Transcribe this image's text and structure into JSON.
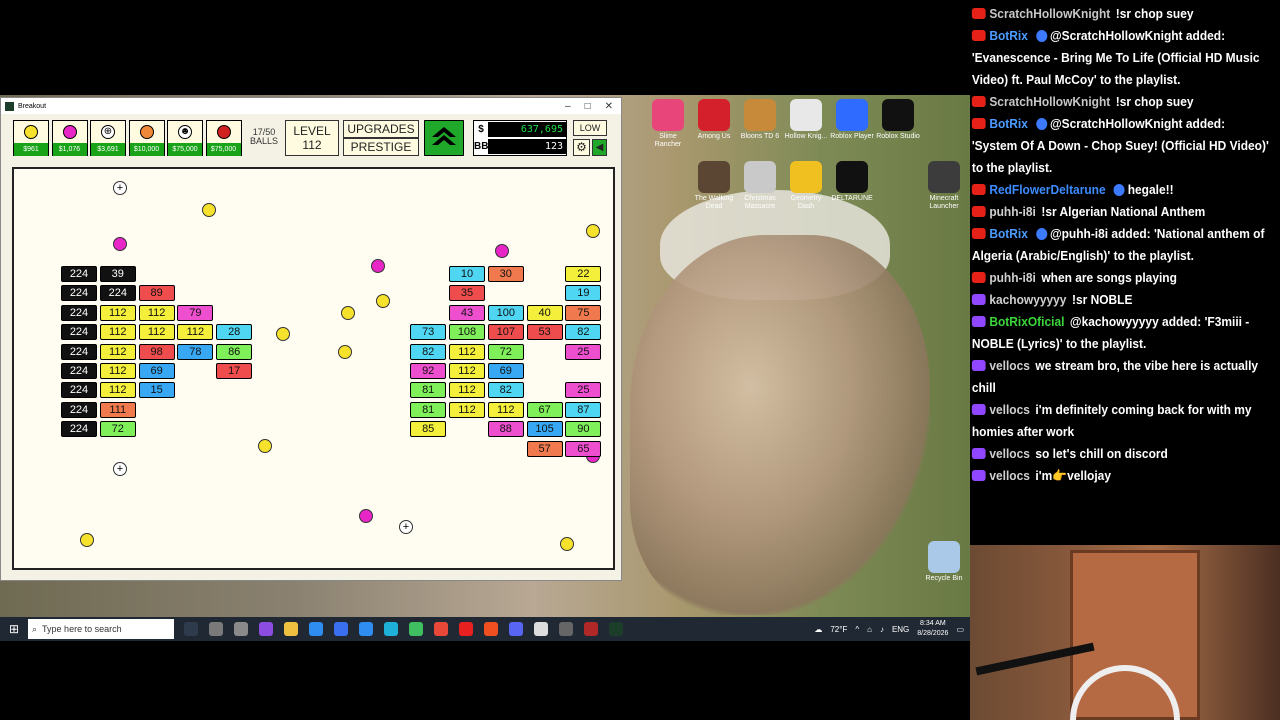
{
  "window": {
    "title": "Breakout"
  },
  "hud": {
    "balls": [
      {
        "icon": "yellow-ball",
        "price": "$961",
        "color": "#f6e22c",
        "glyph": ""
      },
      {
        "icon": "pink-ball",
        "price": "$1,076",
        "color": "#e826c8",
        "glyph": ""
      },
      {
        "icon": "plus-ball",
        "price": "$3,691",
        "color": "#ffffff",
        "glyph": "⊕"
      },
      {
        "icon": "orange-ball",
        "price": "$10,000",
        "color": "#f0883a",
        "glyph": ""
      },
      {
        "icon": "skull-ball",
        "price": "$75,000",
        "color": "#ffffff",
        "glyph": "☻"
      },
      {
        "icon": "red-ball",
        "price": "$75,000",
        "color": "#d02020",
        "glyph": ""
      }
    ],
    "ball_count": "17/50",
    "balls_label": "BALLS",
    "level_label": "LEVEL",
    "level_value": "112",
    "upgrades_label": "UPGRADES",
    "prestige_label": "PRESTIGE",
    "money_symbol": "$",
    "money_value": "637,695",
    "bb_label": "BB",
    "bb_value": "123",
    "quality_label": "LOW"
  },
  "bricks": [
    {
      "c": 0,
      "r": 0,
      "v": "224",
      "k": "k"
    },
    {
      "c": 1,
      "r": 0,
      "v": "39",
      "k": "k"
    },
    {
      "c": 0,
      "r": 1,
      "v": "224",
      "k": "k"
    },
    {
      "c": 1,
      "r": 1,
      "v": "224",
      "k": "k"
    },
    {
      "c": 2,
      "r": 1,
      "v": "89",
      "k": "red"
    },
    {
      "c": 0,
      "r": 2,
      "v": "224",
      "k": "k"
    },
    {
      "c": 1,
      "r": 2,
      "v": "112",
      "k": "yellow"
    },
    {
      "c": 2,
      "r": 2,
      "v": "112",
      "k": "yellow"
    },
    {
      "c": 3,
      "r": 2,
      "v": "79",
      "k": "pink"
    },
    {
      "c": 0,
      "r": 3,
      "v": "224",
      "k": "k"
    },
    {
      "c": 1,
      "r": 3,
      "v": "112",
      "k": "yellow"
    },
    {
      "c": 2,
      "r": 3,
      "v": "112",
      "k": "yellow"
    },
    {
      "c": 3,
      "r": 3,
      "v": "112",
      "k": "yellow"
    },
    {
      "c": 4,
      "r": 3,
      "v": "28",
      "k": "cyan"
    },
    {
      "c": 0,
      "r": 4,
      "v": "224",
      "k": "k"
    },
    {
      "c": 1,
      "r": 4,
      "v": "112",
      "k": "yellow"
    },
    {
      "c": 2,
      "r": 4,
      "v": "98",
      "k": "red"
    },
    {
      "c": 3,
      "r": 4,
      "v": "78",
      "k": "blue"
    },
    {
      "c": 4,
      "r": 4,
      "v": "86",
      "k": "green"
    },
    {
      "c": 0,
      "r": 5,
      "v": "224",
      "k": "k"
    },
    {
      "c": 1,
      "r": 5,
      "v": "112",
      "k": "yellow"
    },
    {
      "c": 2,
      "r": 5,
      "v": "69",
      "k": "blue"
    },
    {
      "c": 4,
      "r": 5,
      "v": "17",
      "k": "red"
    },
    {
      "c": 0,
      "r": 6,
      "v": "224",
      "k": "k"
    },
    {
      "c": 1,
      "r": 6,
      "v": "112",
      "k": "yellow"
    },
    {
      "c": 2,
      "r": 6,
      "v": "15",
      "k": "blue"
    },
    {
      "c": 0,
      "r": 7,
      "v": "224",
      "k": "k"
    },
    {
      "c": 1,
      "r": 7,
      "v": "111",
      "k": "orange"
    },
    {
      "c": 0,
      "r": 8,
      "v": "224",
      "k": "k"
    },
    {
      "c": 1,
      "r": 8,
      "v": "72",
      "k": "green"
    },
    {
      "c": 10,
      "r": 0,
      "v": "10",
      "k": "cyan"
    },
    {
      "c": 11,
      "r": 0,
      "v": "30",
      "k": "orange"
    },
    {
      "c": 13,
      "r": 0,
      "v": "22",
      "k": "yellow"
    },
    {
      "c": 10,
      "r": 1,
      "v": "35",
      "k": "red"
    },
    {
      "c": 13,
      "r": 1,
      "v": "19",
      "k": "cyan"
    },
    {
      "c": 10,
      "r": 2,
      "v": "43",
      "k": "pink"
    },
    {
      "c": 11,
      "r": 2,
      "v": "100",
      "k": "cyan"
    },
    {
      "c": 12,
      "r": 2,
      "v": "40",
      "k": "yellow"
    },
    {
      "c": 13,
      "r": 2,
      "v": "75",
      "k": "orange"
    },
    {
      "c": 9,
      "r": 3,
      "v": "73",
      "k": "cyan"
    },
    {
      "c": 10,
      "r": 3,
      "v": "108",
      "k": "green"
    },
    {
      "c": 11,
      "r": 3,
      "v": "107",
      "k": "red"
    },
    {
      "c": 12,
      "r": 3,
      "v": "53",
      "k": "red"
    },
    {
      "c": 13,
      "r": 3,
      "v": "82",
      "k": "cyan"
    },
    {
      "c": 9,
      "r": 4,
      "v": "82",
      "k": "cyan"
    },
    {
      "c": 10,
      "r": 4,
      "v": "112",
      "k": "yellow"
    },
    {
      "c": 11,
      "r": 4,
      "v": "72",
      "k": "green"
    },
    {
      "c": 13,
      "r": 4,
      "v": "25",
      "k": "pink"
    },
    {
      "c": 9,
      "r": 5,
      "v": "92",
      "k": "pink"
    },
    {
      "c": 10,
      "r": 5,
      "v": "112",
      "k": "yellow"
    },
    {
      "c": 11,
      "r": 5,
      "v": "69",
      "k": "blue"
    },
    {
      "c": 9,
      "r": 6,
      "v": "81",
      "k": "green"
    },
    {
      "c": 10,
      "r": 6,
      "v": "112",
      "k": "yellow"
    },
    {
      "c": 11,
      "r": 6,
      "v": "82",
      "k": "cyan"
    },
    {
      "c": 13,
      "r": 6,
      "v": "25",
      "k": "pink"
    },
    {
      "c": 9,
      "r": 7,
      "v": "81",
      "k": "green"
    },
    {
      "c": 10,
      "r": 7,
      "v": "112",
      "k": "yellow"
    },
    {
      "c": 11,
      "r": 7,
      "v": "112",
      "k": "yellow"
    },
    {
      "c": 12,
      "r": 7,
      "v": "67",
      "k": "green"
    },
    {
      "c": 13,
      "r": 7,
      "v": "87",
      "k": "cyan"
    },
    {
      "c": 9,
      "r": 8,
      "v": "85",
      "k": "yellow"
    },
    {
      "c": 11,
      "r": 8,
      "v": "88",
      "k": "pink"
    },
    {
      "c": 12,
      "r": 8,
      "v": "105",
      "k": "blue"
    },
    {
      "c": 13,
      "r": 8,
      "v": "90",
      "k": "green"
    },
    {
      "c": 12,
      "r": 9,
      "v": "57",
      "k": "orange"
    },
    {
      "c": 13,
      "r": 9,
      "v": "65",
      "k": "pink"
    }
  ],
  "brick_colors": {
    "k": "#111111",
    "red": "#ef4d4d",
    "yellow": "#f4ef3a",
    "pink": "#ee4fcf",
    "cyan": "#4fd6f2",
    "blue": "#38a8f4",
    "green": "#7ff05a",
    "orange": "#f07a4e"
  },
  "desktop_icons": [
    {
      "name": "slime-rancher",
      "label": "Slime Rancher",
      "color": "#e8457b"
    },
    {
      "name": "among-us",
      "label": "Among Us",
      "color": "#d4202a"
    },
    {
      "name": "bloons-td6",
      "label": "Bloons TD 6",
      "color": "#c78a3b"
    },
    {
      "name": "hollow-knight",
      "label": "Hollow Knig...",
      "color": "#e8e8e8"
    },
    {
      "name": "roblox-player",
      "label": "Roblox Player",
      "color": "#2f6bff"
    },
    {
      "name": "roblox-studio",
      "label": "Roblox Studio",
      "color": "#111111"
    },
    {
      "name": "walking-dead",
      "label": "The Walking Dead",
      "color": "#5a4632"
    },
    {
      "name": "christmas-massacre",
      "label": "Christmas Massacre",
      "color": "#c9c9c9"
    },
    {
      "name": "geometry-dash",
      "label": "Geometry Dash",
      "color": "#f0c020"
    },
    {
      "name": "deltarune",
      "label": "DELTARUNE",
      "color": "#111111"
    },
    {
      "name": "minecraft",
      "label": "Minecraft Launcher",
      "color": "#3c3c3c"
    },
    {
      "name": "recycle-bin",
      "label": "Recycle Bin",
      "color": "#aac8e8"
    }
  ],
  "taskbar": {
    "search_placeholder": "Type here to search",
    "weather": "72°F",
    "lang": "ENG",
    "time": "8:34 AM",
    "date": "8/28/2026"
  },
  "chat": [
    {
      "p": "yt",
      "u": "ScratchHollowKnight",
      "uc": "scratch",
      "b": false,
      "t": "!sr chop suey"
    },
    {
      "p": "yt",
      "u": "BotRix",
      "uc": "botrix",
      "b": true,
      "t": "@ScratchHollowKnight added: 'Evanescence - Bring Me To Life (Official HD Music Video) ft. Paul McCoy' to the playlist."
    },
    {
      "p": "yt",
      "u": "ScratchHollowKnight",
      "uc": "scratch",
      "b": false,
      "t": "!sr chop suey"
    },
    {
      "p": "yt",
      "u": "BotRix",
      "uc": "botrix",
      "b": true,
      "t": "@ScratchHollowKnight added: 'System Of A Down - Chop Suey! (Official HD Video)' to the playlist."
    },
    {
      "p": "yt",
      "u": "RedFlowerDeltarune",
      "uc": "red",
      "b": true,
      "t": "hegale!!"
    },
    {
      "p": "yt",
      "u": "puhh-i8i",
      "uc": "puhh",
      "b": false,
      "t": "!sr Algerian National Anthem"
    },
    {
      "p": "yt",
      "u": "BotRix",
      "uc": "botrix",
      "b": true,
      "t": "@puhh-i8i added: 'National anthem of Algeria (Arabic/English)' to the playlist."
    },
    {
      "p": "yt",
      "u": "puhh-i8i",
      "uc": "puhh",
      "b": false,
      "t": "when are songs playing"
    },
    {
      "p": "tw",
      "u": "kachowyyyyy",
      "uc": "ka",
      "b": false,
      "t": "!sr NOBLE"
    },
    {
      "p": "tw",
      "u": "BotRixOficial",
      "uc": "botrixo",
      "b": false,
      "t": "@kachowyyyyy added: 'F3miii - NOBLE (Lyrics)' to the playlist."
    },
    {
      "p": "tw",
      "u": "vellocs",
      "uc": "vel",
      "b": false,
      "t": "we stream bro, the vibe here is actually chill"
    },
    {
      "p": "tw",
      "u": "vellocs",
      "uc": "vel",
      "b": false,
      "t": "i'm definitely coming back for with my homies after work"
    },
    {
      "p": "tw",
      "u": "vellocs",
      "uc": "vel",
      "b": false,
      "t": "so let's chill on discord"
    },
    {
      "p": "tw",
      "u": "vellocs",
      "uc": "vel",
      "b": false,
      "t": "i'm👉vellojay"
    }
  ]
}
